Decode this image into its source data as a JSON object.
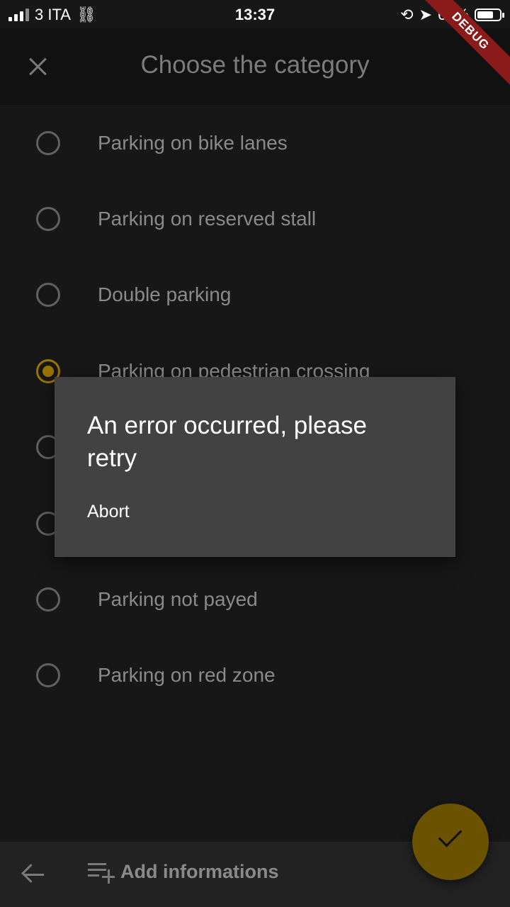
{
  "status_bar": {
    "carrier": "3 ITA",
    "time": "13:37",
    "battery": "64%"
  },
  "debug_banner": "DEBUG",
  "app_bar": {
    "title": "Choose the category"
  },
  "categories": [
    {
      "label": "Parking on bike lanes",
      "selected": false
    },
    {
      "label": "Parking on reserved stall",
      "selected": false
    },
    {
      "label": "Double parking",
      "selected": false
    },
    {
      "label": "Parking on pedestrian crossing",
      "selected": true
    },
    {
      "label": "",
      "selected": false
    },
    {
      "label": "",
      "selected": false
    },
    {
      "label": "Parking not payed",
      "selected": false
    },
    {
      "label": "Parking on red zone",
      "selected": false
    }
  ],
  "dialog": {
    "title": "An error occurred, please retry",
    "action": "Abort"
  },
  "bottom_bar": {
    "add_info_label": "Add informations"
  },
  "colors": {
    "accent": "#9a7400",
    "background": "#171717",
    "dialog": "#424242"
  }
}
